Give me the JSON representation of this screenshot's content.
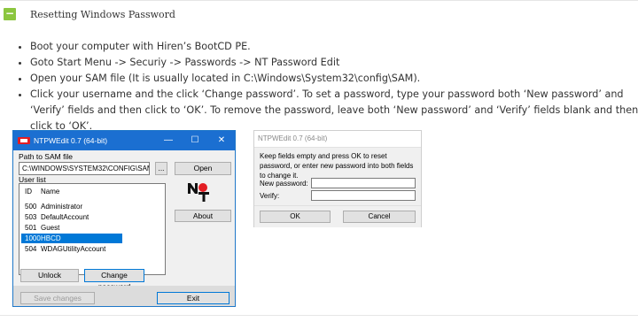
{
  "accordion": {
    "toggle_symbol": "−",
    "title": "Resetting Windows Password"
  },
  "steps": [
    "Boot your computer with Hiren’s BootCD PE.",
    "Goto Start Menu -> Securiy -> Passwords -> NT Password Edit",
    "Open your SAM file (It is usually located in C:\\Windows\\System32\\config\\SAM).",
    "Click your username and the click ‘Change password’. To set a password, type your password both ‘New password’ and ‘Verify’ fields and then click to ‘OK’. To remove the password, leave both ‘New password’ and ‘Verify’ fields blank and then click to ‘OK’."
  ],
  "ntpwedit_main": {
    "title": "NTPWEdit 0.7 (64-bit)",
    "minimize": "—",
    "maximize": "☐",
    "close": "✕",
    "sam_label": "Path to SAM file",
    "sam_path": "C:\\WINDOWS\\SYSTEM32\\CONFIG\\SAM",
    "browse_label": "...",
    "open_label": "Open",
    "user_list_label": "User list",
    "col_id": "ID",
    "col_name": "Name",
    "users": [
      {
        "id": "500",
        "name": "Administrator"
      },
      {
        "id": "503",
        "name": "DefaultAccount"
      },
      {
        "id": "501",
        "name": "Guest"
      },
      {
        "id": "1000",
        "name": "HBCD"
      },
      {
        "id": "504",
        "name": "WDAGUtilityAccount"
      }
    ],
    "selected_user": "HBCD",
    "about_label": "About",
    "unlock_label": "Unlock",
    "change_password_label": "Change password",
    "save_changes_label": "Save changes",
    "exit_label": "Exit",
    "logo_colors": {
      "red": "#e31e24",
      "black": "#111111"
    }
  },
  "ntpwedit_dialog": {
    "title": "NTPWEdit 0.7 (64-bit)",
    "message": "Keep fields empty and press OK to reset password, or enter new password into both fields to change it.",
    "new_password_label": "New password:",
    "new_password_value": "",
    "verify_label": "Verify:",
    "verify_value": "",
    "ok_label": "OK",
    "cancel_label": "Cancel"
  }
}
